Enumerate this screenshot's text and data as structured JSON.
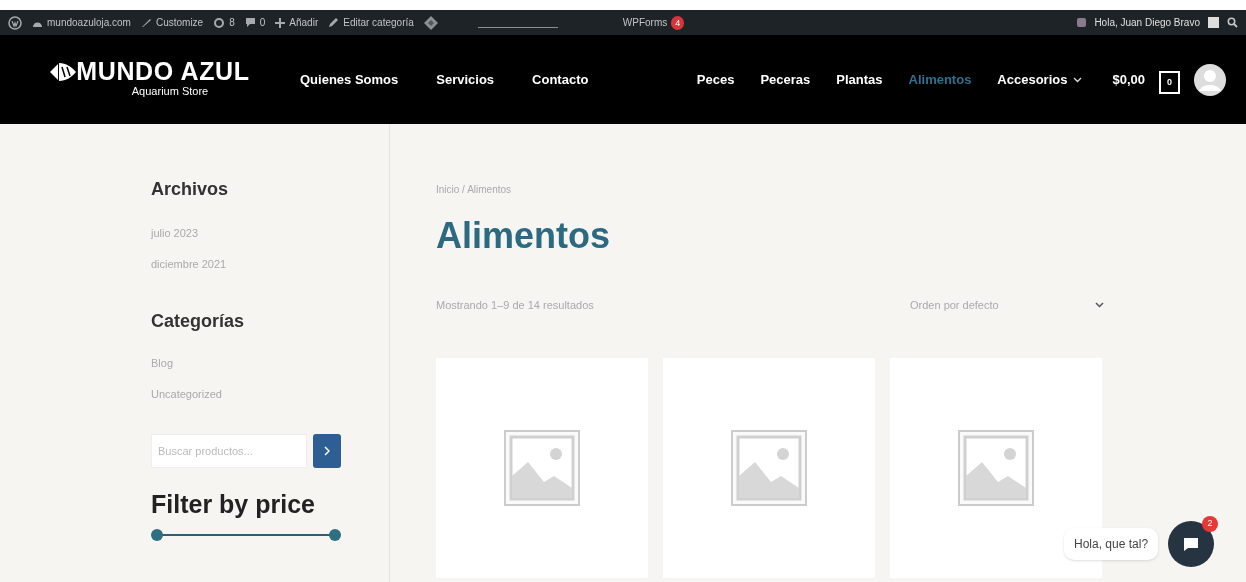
{
  "admin_bar": {
    "site": "mundoazuloja.com",
    "customize": "Customize",
    "updates": "8",
    "comments": "0",
    "add": "Añadir",
    "edit": "Editar categoría",
    "wpforms": "WPForms",
    "wpforms_count": "4",
    "greeting": "Hola, Juan Diego Bravo"
  },
  "header": {
    "logo": "MUNDO AZUL",
    "tagline": "Aquarium Store",
    "left_menu": [
      {
        "label": "Quienes Somos",
        "selected": false
      },
      {
        "label": "Servicios",
        "selected": false
      },
      {
        "label": "Contacto",
        "selected": false
      }
    ],
    "right_menu": [
      {
        "label": "Peces",
        "selected": false,
        "dropdown": false
      },
      {
        "label": "Peceras",
        "selected": false,
        "dropdown": false
      },
      {
        "label": "Plantas",
        "selected": false,
        "dropdown": false
      },
      {
        "label": "Alimentos",
        "selected": true,
        "dropdown": false
      },
      {
        "label": "Accesorios",
        "selected": false,
        "dropdown": true
      }
    ],
    "cart_total": "$0,00",
    "cart_count": "0"
  },
  "sidebar": {
    "archives_title": "Archivos",
    "archives": [
      "julio 2023",
      "diciembre 2021"
    ],
    "categories_title": "Categorías",
    "categories": [
      "Blog",
      "Uncategorized"
    ],
    "search": {
      "placeholder": "Buscar productos..."
    },
    "price_filter": {
      "title": "Filter by price",
      "level": 1
    }
  },
  "main": {
    "breadcrumb": "Inicio / Alimentos",
    "title": "Alimentos",
    "result_count": "Mostrando 1–9 de 14 resultados",
    "sort": "Orden por defecto"
  },
  "chat": {
    "message": "Hola, que tal?",
    "badge": "2"
  }
}
